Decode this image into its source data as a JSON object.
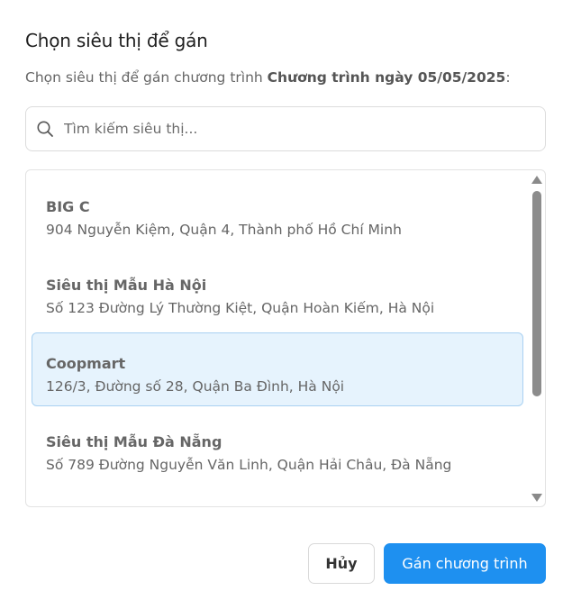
{
  "dialog": {
    "title": "Chọn siêu thị để gán",
    "subtitle_prefix": "Chọn siêu thị để gán chương trình ",
    "program_name": "Chương trình ngày 05/05/2025",
    "subtitle_suffix": ":"
  },
  "search": {
    "placeholder": "Tìm kiếm siêu thị...",
    "value": "",
    "icon": "search-icon"
  },
  "supermarkets": [
    {
      "name": "BIG C",
      "address": "904 Nguyễn Kiệm, Quận 4, Thành phố Hồ Chí Minh",
      "selected": false
    },
    {
      "name": "Siêu thị Mẫu Hà Nội",
      "address": "Số 123 Đường Lý Thường Kiệt, Quận Hoàn Kiếm, Hà Nội",
      "selected": false
    },
    {
      "name": "Coopmart",
      "address": "126/3, Đường số 28, Quận Ba Đình, Hà Nội",
      "selected": true
    },
    {
      "name": "Siêu thị Mẫu Đà Nẵng",
      "address": "Số 789 Đường Nguyễn Văn Linh, Quận Hải Châu, Đà Nẵng",
      "selected": false
    }
  ],
  "buttons": {
    "cancel_label": "Hủy",
    "assign_label": "Gán chương trình"
  },
  "colors": {
    "primary": "#1e90f0",
    "selected_bg": "#e6f3fd",
    "selected_border": "#a9d1f2"
  }
}
